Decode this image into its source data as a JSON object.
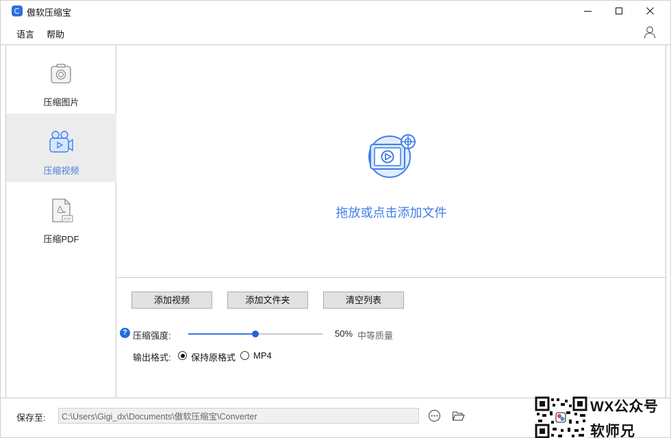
{
  "app": {
    "title": "傲软压缩宝"
  },
  "window_controls": {
    "minimize": "minimize",
    "maximize": "maximize",
    "close": "close"
  },
  "menu": {
    "language": "语言",
    "help": "帮助"
  },
  "sidebar": {
    "items": [
      {
        "label": "压缩图片",
        "icon": "camera-icon",
        "active": false
      },
      {
        "label": "压缩视频",
        "icon": "video-camera-icon",
        "active": true
      },
      {
        "label": "压缩PDF",
        "icon": "pdf-file-icon",
        "active": false
      }
    ]
  },
  "dropzone": {
    "text": "拖放或点击添加文件",
    "icon": "add-video-icon"
  },
  "buttons": {
    "add_video": "添加视频",
    "add_folder": "添加文件夹",
    "clear_list": "清空列表"
  },
  "compression": {
    "label": "压缩强度:",
    "value_percent": 50,
    "value_text": "50%",
    "quality_text": "中等质量",
    "help_symbol": "?"
  },
  "output_format": {
    "label": "输出格式:",
    "options": [
      {
        "label": "保持原格式",
        "selected": true
      },
      {
        "label": "MP4",
        "selected": false
      }
    ]
  },
  "save": {
    "label": "保存至:",
    "path": "C:\\Users\\Gigi_dx\\Documents\\傲软压缩宝\\Converter"
  },
  "watermark": {
    "line1": "WX公众号",
    "line2": "软师兄"
  },
  "colors": {
    "accent": "#3f7ee8",
    "active_bg": "#ececec",
    "button_bg": "#e1e1e1"
  }
}
